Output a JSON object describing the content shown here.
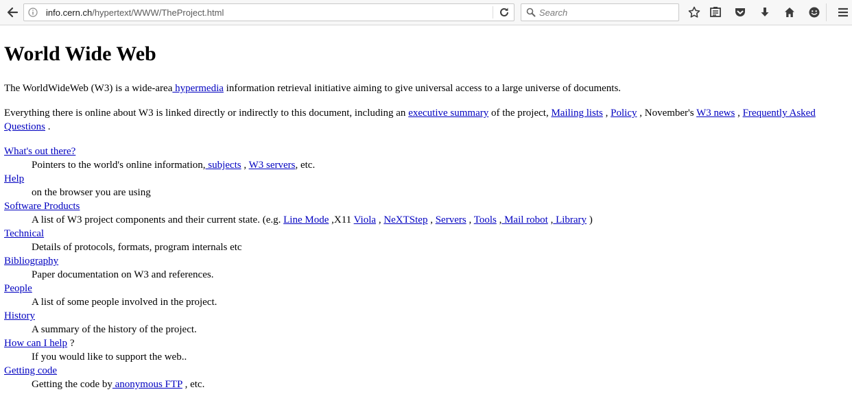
{
  "browser": {
    "url_host": "info.cern.ch",
    "url_path": "/hypertext/WWW/TheProject.html",
    "search_placeholder": "Search"
  },
  "page": {
    "title": "World Wide Web",
    "intro": {
      "pre": "The WorldWideWeb (W3) is a wide-area",
      "link": " hypermedia",
      "post": " information retrieval initiative aiming to give universal access to a large universe of documents."
    },
    "everything": {
      "t1": "Everything there is online about W3 is linked directly or indirectly to this document, including an ",
      "l1": "executive summary",
      "t2": " of the project, ",
      "l2": "Mailing lists",
      "t3": " , ",
      "l3": "Policy",
      "t4": " , November's ",
      "l4": "W3 news",
      "t5": " , ",
      "l5": "Frequently Asked Questions",
      "t6": " ."
    },
    "sections": {
      "whats_out": {
        "term": "What's out there?",
        "desc_pre": "Pointers to the world's online information,",
        "link1": " subjects",
        "mid": " , ",
        "link2": "W3 servers",
        "post": ", etc."
      },
      "help": {
        "term": "Help",
        "desc": "on the browser you are using"
      },
      "software": {
        "term": "Software Products",
        "desc_pre": "A list of W3 project components and their current state. (e.g. ",
        "line_mode": "Line Mode",
        "x11": " ,X11 ",
        "viola": "Viola",
        "sep1": " , ",
        "nextstep": "NeXTStep",
        "sep2": " , ",
        "servers": "Servers",
        "sep3": " , ",
        "tools": "Tools",
        "sep4": " ,",
        "mail_robot": " Mail robot",
        "sep5": " ,",
        "library": " Library",
        "close": " )"
      },
      "technical": {
        "term": "Technical",
        "desc": "Details of protocols, formats, program internals etc"
      },
      "bibliography": {
        "term": "Bibliography",
        "desc": "Paper documentation on W3 and references."
      },
      "people": {
        "term": "People",
        "desc": "A list of some people involved in the project."
      },
      "history": {
        "term": "History",
        "desc": "A summary of the history of the project."
      },
      "how_help": {
        "term": "How can I help",
        "term_post": " ?",
        "desc": "If you would like to support the web.."
      },
      "getting_code": {
        "term": "Getting code",
        "desc_pre": "Getting the code by",
        "link": " anonymous FTP",
        "post": " , etc."
      }
    }
  },
  "colors": {
    "link": "#0000c0",
    "toolbar_bg": "#f7f7f7",
    "icon": "#3c3c3c"
  },
  "icons": [
    "back-icon",
    "info-icon",
    "reload-icon",
    "search-icon",
    "bookmark-star-icon",
    "reading-list-icon",
    "pocket-icon",
    "download-icon",
    "home-icon",
    "smiley-icon",
    "menu-icon"
  ]
}
